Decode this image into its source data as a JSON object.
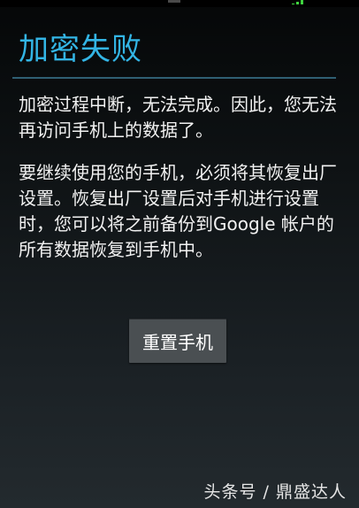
{
  "dialog": {
    "title": "加密失败",
    "paragraph_1": "加密过程中断，无法完成。因此，您无法再访问手机上的数据了。",
    "paragraph_2": "要继续使用您的手机，必须将其恢复出厂设置。恢复出厂设置后对手机进行设置时，您可以将之前备份到Google 帐户的所有数据恢复到手机中。",
    "reset_button_label": "重置手机"
  },
  "watermark": {
    "text": "头条号 / 鼎盛达人"
  },
  "colors": {
    "title_accent": "#33b5e5",
    "divider": "#2f5f73",
    "button_bg": "#4a4f52",
    "signal": "#3fd33f"
  },
  "icons": {
    "status_signal": "signal-icon"
  }
}
